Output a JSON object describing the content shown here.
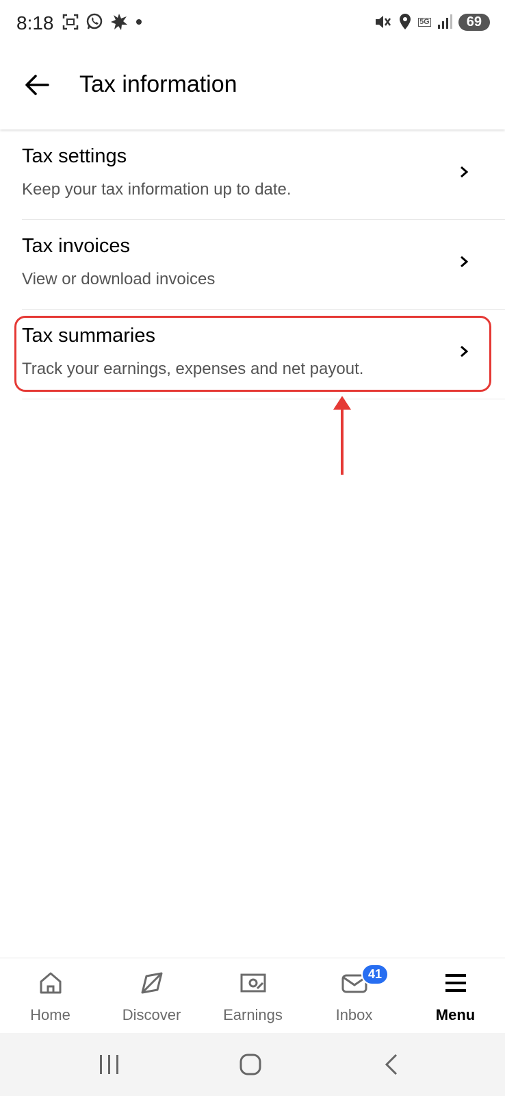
{
  "status_bar": {
    "time": "8:18",
    "network": "5G",
    "battery": "69",
    "left_icons": [
      "screenshot-icon",
      "whatsapp-icon",
      "burst-icon",
      "dot-icon"
    ],
    "right_icons": [
      "mute-vibrate-icon",
      "location-icon",
      "network-5g-icon",
      "signal-icon",
      "battery-icon"
    ]
  },
  "header": {
    "title": "Tax information",
    "back_icon": "arrow-left-icon"
  },
  "list": [
    {
      "title": "Tax settings",
      "subtitle": "Keep your tax information up to date."
    },
    {
      "title": "Tax invoices",
      "subtitle": "View or download invoices"
    },
    {
      "title": "Tax summaries",
      "subtitle": "Track your earnings, expenses and net payout."
    }
  ],
  "annotation": {
    "color": "#e53935"
  },
  "bottom_nav": {
    "items": [
      {
        "label": "Home",
        "icon": "home-icon",
        "active": false
      },
      {
        "label": "Discover",
        "icon": "compass-icon",
        "active": false
      },
      {
        "label": "Earnings",
        "icon": "cash-icon",
        "active": false
      },
      {
        "label": "Inbox",
        "icon": "mail-icon",
        "active": false,
        "badge": "41"
      },
      {
        "label": "Menu",
        "icon": "menu-icon",
        "active": true
      }
    ],
    "badge_color": "#276ef1"
  },
  "system_nav": {
    "icons": [
      "recents-icon",
      "home-circle-icon",
      "back-chevron-icon"
    ]
  }
}
